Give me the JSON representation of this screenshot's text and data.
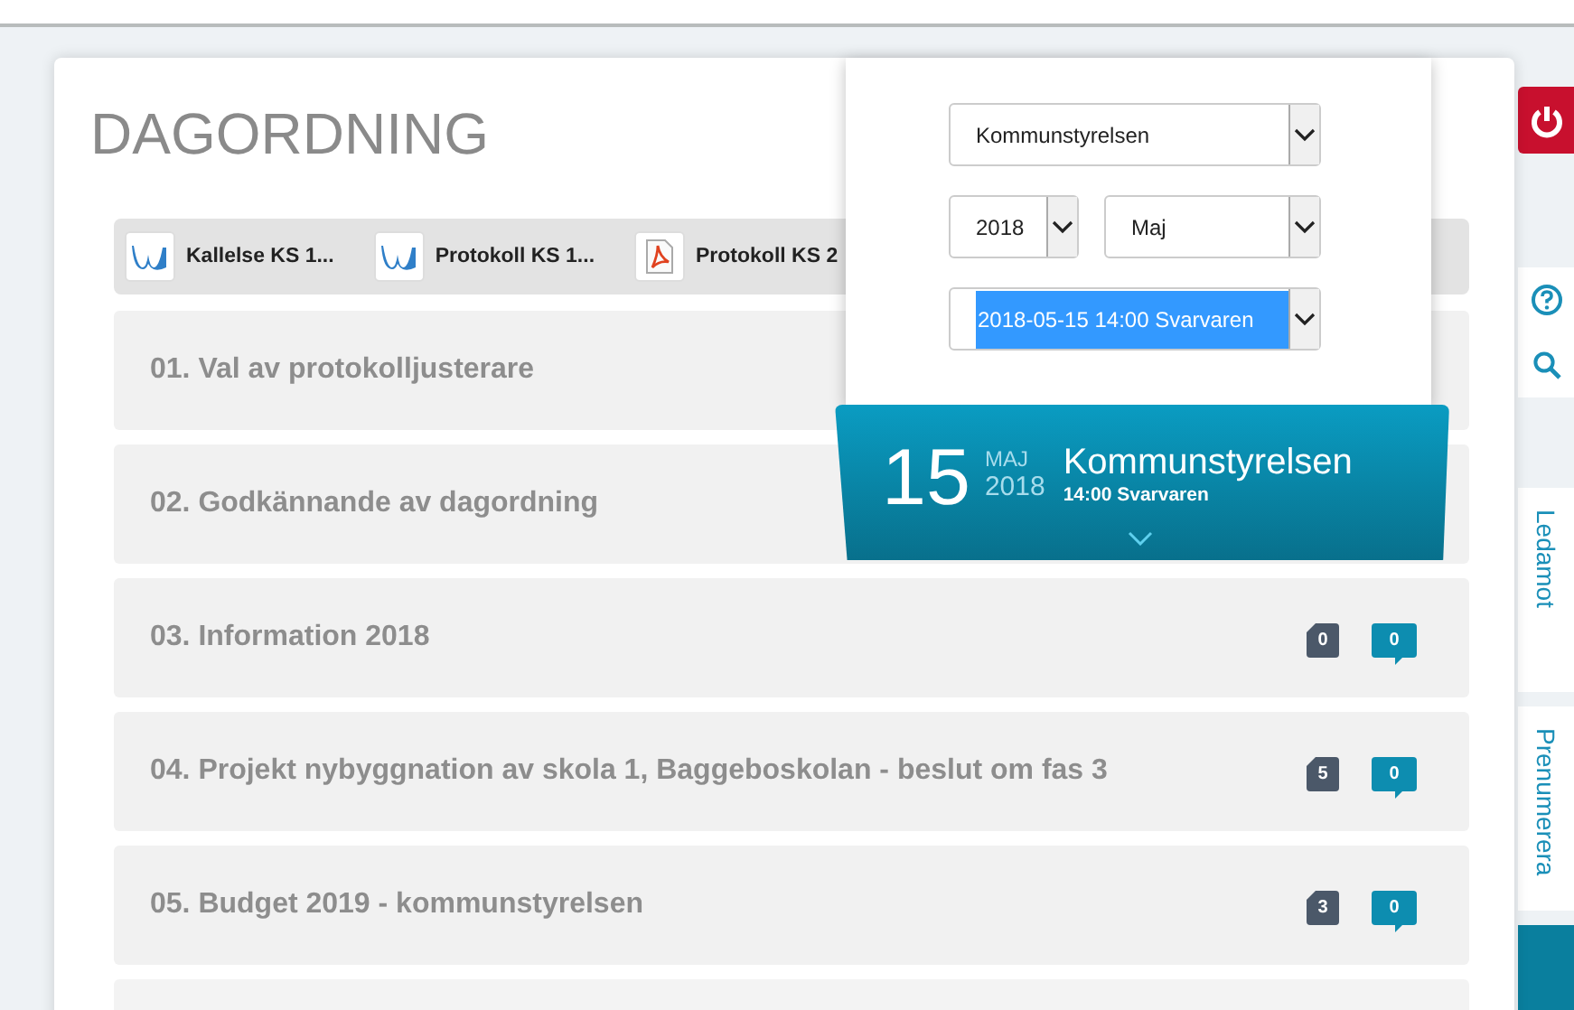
{
  "title": "DAGORDNING",
  "documents": [
    {
      "kind": "word",
      "name": "Kallelse KS 1..."
    },
    {
      "kind": "word",
      "name": "Protokoll KS 1..."
    },
    {
      "kind": "pdf",
      "name": "Protokoll KS 2"
    }
  ],
  "items": [
    {
      "kind": "agenda",
      "title": "01. Val av protokolljusterare"
    },
    {
      "kind": "agenda",
      "title": "02. Godkännande av dagordning"
    },
    {
      "kind": "agenda",
      "title": "03. Information 2018",
      "documents": "0",
      "comments": "0"
    },
    {
      "kind": "agenda",
      "title": "04. Projekt nybyggnation av skola 1, Baggeboskolan - beslut om fas 3",
      "documents": "5",
      "comments": "0"
    },
    {
      "kind": "agenda",
      "title": "05. Budget 2019 - kommunstyrelsen",
      "documents": "3",
      "comments": "0"
    },
    {
      "kind": "blank"
    }
  ],
  "filter": {
    "dropdowns": [
      {
        "kind": "wide",
        "value": "Kommunstyrelsen",
        "focused": false
      },
      {
        "kind": "narrow",
        "value": "2018",
        "focused": false
      },
      {
        "kind": "medium",
        "value": "Maj",
        "focused": false
      },
      {
        "kind": "wide",
        "value": "2018-05-15 14:00 Svarvaren",
        "focused": true
      }
    ]
  },
  "meeting": {
    "day": "15",
    "month": "MAJ",
    "year": "2018",
    "body": "Kommunstyrelsen",
    "time_place": "14:00 Svarvaren"
  },
  "sidebar": {
    "tabs": [
      {
        "label": "Ledamot",
        "selected": false
      },
      {
        "label": "Prenumerera",
        "selected": false
      },
      {
        "selected": true
      }
    ]
  }
}
